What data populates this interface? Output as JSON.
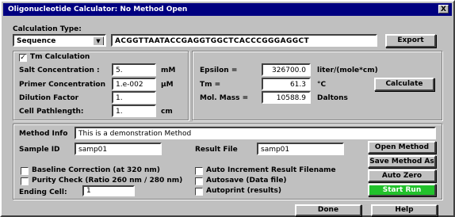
{
  "window": {
    "title": "Oligonucleotide Calculator:  No Method Open",
    "close": "X"
  },
  "calc_type": {
    "label": "Calculation Type:",
    "selected": "Sequence",
    "sequence_value": "ACGGTTAATACCGAGGTGGCTCACCCGGGAGGCT",
    "export_label": "Export"
  },
  "tm": {
    "checkbox_label": "Tm  Calculation",
    "checked": true,
    "salt_label": "Salt Concentration :",
    "salt_value": "5.",
    "salt_unit": "mM",
    "primer_label": "Primer Concentration",
    "primer_value": "1.e-002",
    "primer_unit": "µM",
    "dilution_label": "Dilution Factor",
    "dilution_value": "1.",
    "path_label": "Cell Pathlength:",
    "path_value": "1.",
    "path_unit": "cm"
  },
  "results": {
    "epsilon_label": "Epsilon =",
    "epsilon_value": "326700.0",
    "epsilon_unit": "liter/(mole*cm)",
    "tm_label": "Tm =",
    "tm_value": "61.3",
    "tm_unit": "°C",
    "mass_label": "Mol. Mass =",
    "mass_value": "10588.9",
    "mass_unit": "Daltons",
    "calculate_label": "Calculate"
  },
  "method": {
    "info_label": "Method Info",
    "info_value": "This is a demonstration Method",
    "sample_label": "Sample ID",
    "sample_value": "samp01",
    "result_label": "Result File",
    "result_value": "samp01",
    "baseline_label": "Baseline Correction (at 320 nm)",
    "purity_label": "Purity Check (Ratio 260 nm / 280 nm)",
    "ending_label": "Ending Cell:",
    "ending_value": "1",
    "auto_increment_label": "Auto Increment Result Filename",
    "autosave_label": "Autosave (Data file)",
    "autoprint_label": "Autoprint (results)",
    "open_method": "Open Method",
    "save_method": "Save Method As",
    "auto_zero": "Auto Zero",
    "start_run": "Start Run"
  },
  "footer": {
    "done": "Done",
    "help": "Help"
  },
  "colors": {
    "titlebar": "#000080",
    "start_run": "#22c22c",
    "face": "#c0c0c0"
  }
}
